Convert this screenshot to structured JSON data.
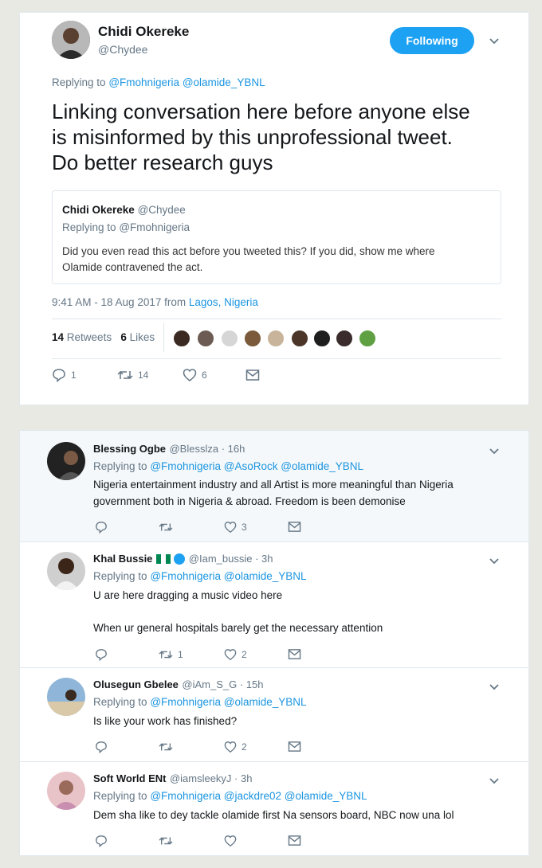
{
  "main": {
    "name": "Chidi Okereke",
    "handle": "@Chydee",
    "follow_label": "Following",
    "replying_prefix": "Replying to",
    "replying_to": [
      "@Fmohnigeria",
      "@olamide_YBNL"
    ],
    "text_lines": [
      "Linking conversation here before anyone else",
      "is misinformed by this unprofessional tweet.",
      "Do better research guys"
    ],
    "quoted": {
      "name": "Chidi Okereke",
      "handle": "@Chydee",
      "replying_prefix": "Replying to",
      "replying_to": "@Fmohnigeria",
      "text_lines": [
        "Did you even read this act before you tweeted this? If you did, show me where",
        "Olamide contravened the act."
      ]
    },
    "timestamp": "9:41 AM - 18 Aug 2017 from",
    "location": "Lagos, Nigeria",
    "retweets_count": "14",
    "retweets_label": "Retweets",
    "likes_count": "6",
    "likes_label": "Likes",
    "actions": {
      "reply": "1",
      "retweet": "14",
      "like": "6"
    }
  },
  "replies": [
    {
      "name": "Blessing Ogbe",
      "meta": "@Blesslza · 16h",
      "replying_prefix": "Replying to",
      "replying_to": "@Fmohnigeria @AsoRock @olamide_YBNL",
      "lines": [
        "Nigeria entertainment industry and all Artist is more meaningful than Nigeria",
        "government both in Nigeria & abroad. Freedom is been demonise"
      ],
      "reply_count": "",
      "retweet_count": "",
      "like_count": "3"
    },
    {
      "name": "Khal Bussie",
      "meta": "@Iam_bussie · 3h",
      "replying_prefix": "Replying to",
      "replying_to": "@Fmohnigeria @olamide_YBNL",
      "lines": [
        "U are here dragging a music video here",
        "When ur general hospitals barely get the necessary attention"
      ],
      "reply_count": "",
      "retweet_count": "1",
      "like_count": "2"
    },
    {
      "name": "Olusegun Gbelee",
      "meta": "@iAm_S_G · 15h",
      "replying_prefix": "Replying to",
      "replying_to": "@Fmohnigeria @olamide_YBNL",
      "lines": [
        "Is like your work has finished?"
      ],
      "reply_count": "",
      "retweet_count": "",
      "like_count": "2"
    },
    {
      "name": "Soft World ENt",
      "meta": "@iamsleekyJ · 3h",
      "replying_prefix": "Replying to",
      "replying_to": "@Fmohnigeria @jackdre02 @olamide_YBNL",
      "lines": [
        "Dem sha like to dey tackle olamide first Na sensors board, NBC now una lol"
      ],
      "reply_count": "",
      "retweet_count": "",
      "like_count": ""
    }
  ],
  "colors": {
    "link": "#1b95e0",
    "muted": "#657786",
    "follow_bg": "#1da1f2",
    "highlight_bg": "#f5f8fa"
  },
  "icons": [
    "reply-icon",
    "retweet-icon",
    "like-icon",
    "message-icon",
    "chevron-down-icon",
    "verified-icon",
    "nigeria-flag-icon"
  ]
}
